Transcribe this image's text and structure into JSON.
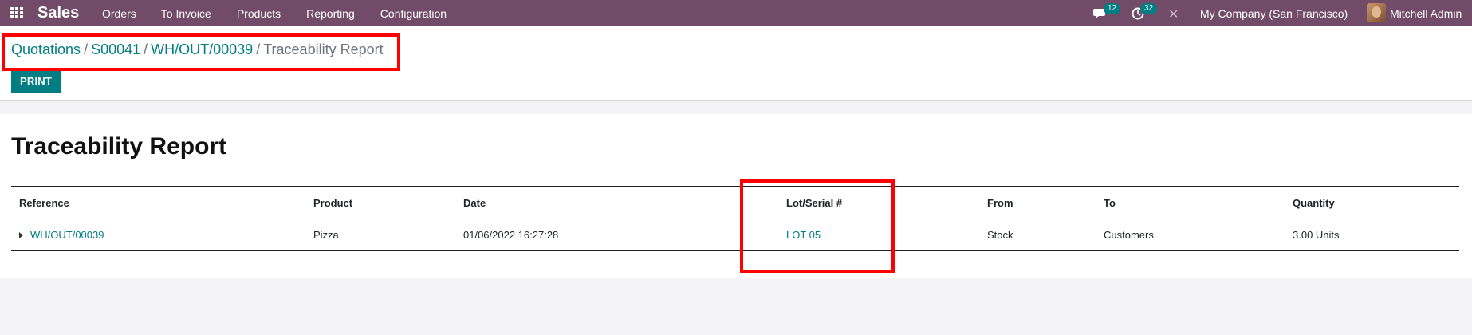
{
  "navbar": {
    "app_title": "Sales",
    "menu": [
      "Orders",
      "To Invoice",
      "Products",
      "Reporting",
      "Configuration"
    ],
    "messages_count": "12",
    "activities_count": "32",
    "company": "My Company (San Francisco)",
    "user": "Mitchell Admin",
    "brand_color": "#714b67",
    "icons": [
      "apps-icon",
      "chat-icon",
      "activity-clock-icon",
      "debug-icon",
      "avatar"
    ]
  },
  "breadcrumb": {
    "items": [
      "Quotations",
      "S00041",
      "WH/OUT/00039"
    ],
    "current": "Traceability Report",
    "separator": "/"
  },
  "toolbar": {
    "print_label": "PRINT"
  },
  "report": {
    "title": "Traceability Report",
    "columns": [
      "Reference",
      "Product",
      "Date",
      "Lot/Serial #",
      "From",
      "To",
      "Quantity"
    ],
    "rows": [
      {
        "reference": "WH/OUT/00039",
        "product": "Pizza",
        "date": "01/06/2022 16:27:28",
        "lot": "LOT 05",
        "from": "Stock",
        "to": "Customers",
        "quantity": "3.00 Units"
      }
    ]
  },
  "colors": {
    "accent": "#017e84",
    "highlight": "#ff0000"
  }
}
